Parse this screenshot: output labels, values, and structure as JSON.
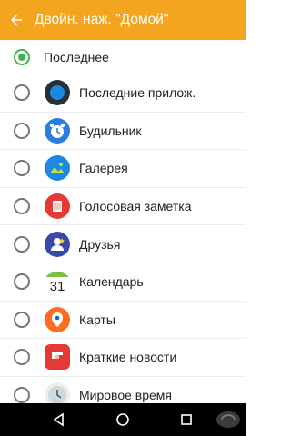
{
  "header": {
    "title": "Двойн. наж. \"Домой\""
  },
  "list": {
    "selected_label": "Последнее",
    "items": [
      {
        "label": "Последние прилож.",
        "icon": "recent-apps-icon"
      },
      {
        "label": "Будильник",
        "icon": "alarm-clock-icon"
      },
      {
        "label": "Галерея",
        "icon": "gallery-icon"
      },
      {
        "label": "Голосовая заметка",
        "icon": "voice-memo-icon"
      },
      {
        "label": "Друзья",
        "icon": "friends-icon"
      },
      {
        "label": "Календарь",
        "icon": "calendar-icon",
        "day": "31"
      },
      {
        "label": "Карты",
        "icon": "maps-icon"
      },
      {
        "label": "Краткие новости",
        "icon": "flipboard-icon"
      },
      {
        "label": "Мировое время",
        "icon": "world-clock-icon"
      }
    ]
  },
  "colors": {
    "accent": "#f4a51f",
    "radio_checked": "#3fb34f"
  }
}
